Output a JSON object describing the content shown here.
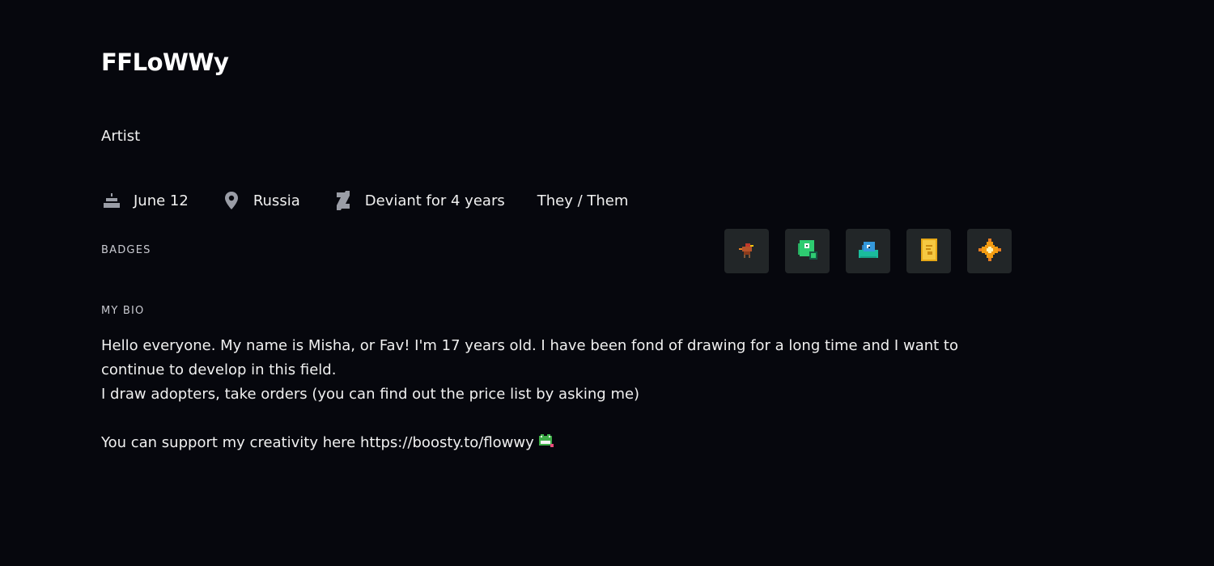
{
  "profile": {
    "username": "FFLoWWy",
    "tagline": "Artist",
    "meta": {
      "birthday": "June 12",
      "location": "Russia",
      "member_since": "Deviant for 4 years",
      "pronouns": "They / Them"
    }
  },
  "badges_section": {
    "label": "BADGES",
    "badges": [
      {
        "icon": "bird-badge-icon"
      },
      {
        "icon": "green-llama-badge-icon"
      },
      {
        "icon": "blue-slime-badge-icon"
      },
      {
        "icon": "gold-card-badge-icon"
      },
      {
        "icon": "orange-star-badge-icon"
      }
    ]
  },
  "bio_section": {
    "label": "MY BIO",
    "line1": "Hello everyone. My name is Misha, or Fav! I'm 17 years old. I have been fond of drawing for a long time and I want to continue to develop in this field.",
    "line2": "I draw adopters, take orders (you can find out the price list by asking me)",
    "support_text": "You can support my creativity here ",
    "support_link": "https://boosty.to/flowwy"
  },
  "colors": {
    "background": "#06070d",
    "text": "#f0f0f0",
    "badge_bg": "#222628",
    "icon": "#9a9da6"
  }
}
